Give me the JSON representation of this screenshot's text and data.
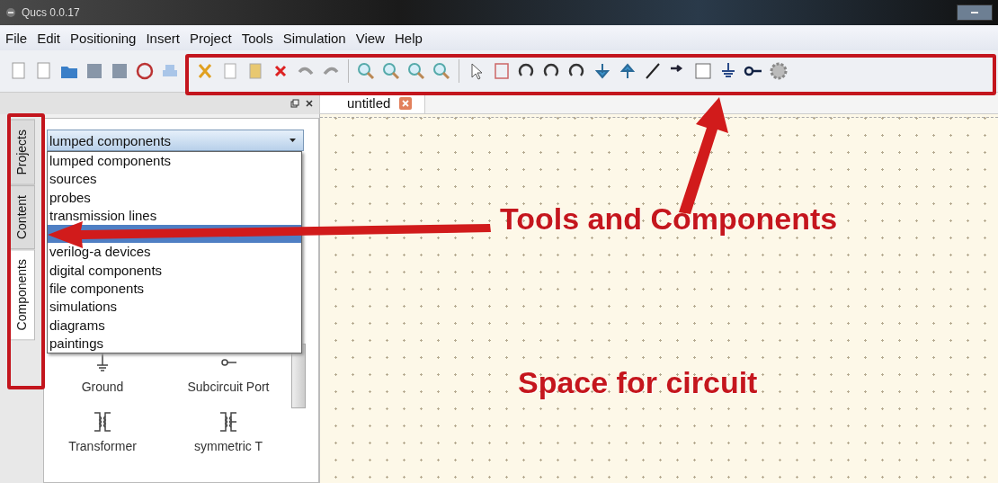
{
  "window": {
    "title": "Qucs 0.0.17"
  },
  "menu": [
    "File",
    "Edit",
    "Positioning",
    "Insert",
    "Project",
    "Tools",
    "Simulation",
    "View",
    "Help"
  ],
  "side_tabs": [
    {
      "label": "Projects",
      "selected": false
    },
    {
      "label": "Content",
      "selected": false
    },
    {
      "label": "Components",
      "selected": true
    }
  ],
  "combo": {
    "value": "lumped components",
    "items": [
      {
        "label": "lumped components",
        "highlighted": false
      },
      {
        "label": "sources",
        "highlighted": false
      },
      {
        "label": "probes",
        "highlighted": false
      },
      {
        "label": "transmission lines",
        "highlighted": false
      },
      {
        "highlighted": true
      },
      {
        "label": "verilog-a devices",
        "highlighted": false
      },
      {
        "label": "digital components",
        "highlighted": false
      },
      {
        "label": "file components",
        "highlighted": false
      },
      {
        "label": "simulations",
        "highlighted": false
      },
      {
        "label": "diagrams",
        "highlighted": false
      },
      {
        "label": "paintings",
        "highlighted": false
      }
    ]
  },
  "components": [
    {
      "label": "Ground",
      "kind": "ground"
    },
    {
      "label": "Subcircuit Port",
      "kind": "port"
    },
    {
      "label": "Transformer",
      "kind": "transformer"
    },
    {
      "label": "symmetric T",
      "kind": "symtransformer"
    }
  ],
  "doc_tabs": [
    {
      "label": "untitled",
      "selected": true
    }
  ],
  "annotations": [
    "Tools and Components",
    "Space for circuit"
  ]
}
